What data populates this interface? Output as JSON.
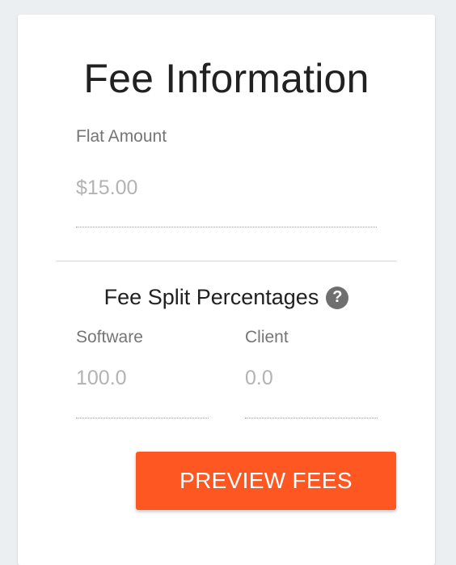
{
  "card": {
    "title": "Fee Information"
  },
  "flat_amount": {
    "label": "Flat Amount",
    "value": "$15.00"
  },
  "fee_split": {
    "heading": "Fee Split Percentages",
    "help_icon": "?",
    "software": {
      "label": "Software",
      "value": "100.0"
    },
    "client": {
      "label": "Client",
      "value": "0.0"
    }
  },
  "actions": {
    "preview_label": "PREVIEW FEES"
  },
  "colors": {
    "accent": "#ff5722",
    "background": "#eceff1",
    "card": "#ffffff"
  }
}
